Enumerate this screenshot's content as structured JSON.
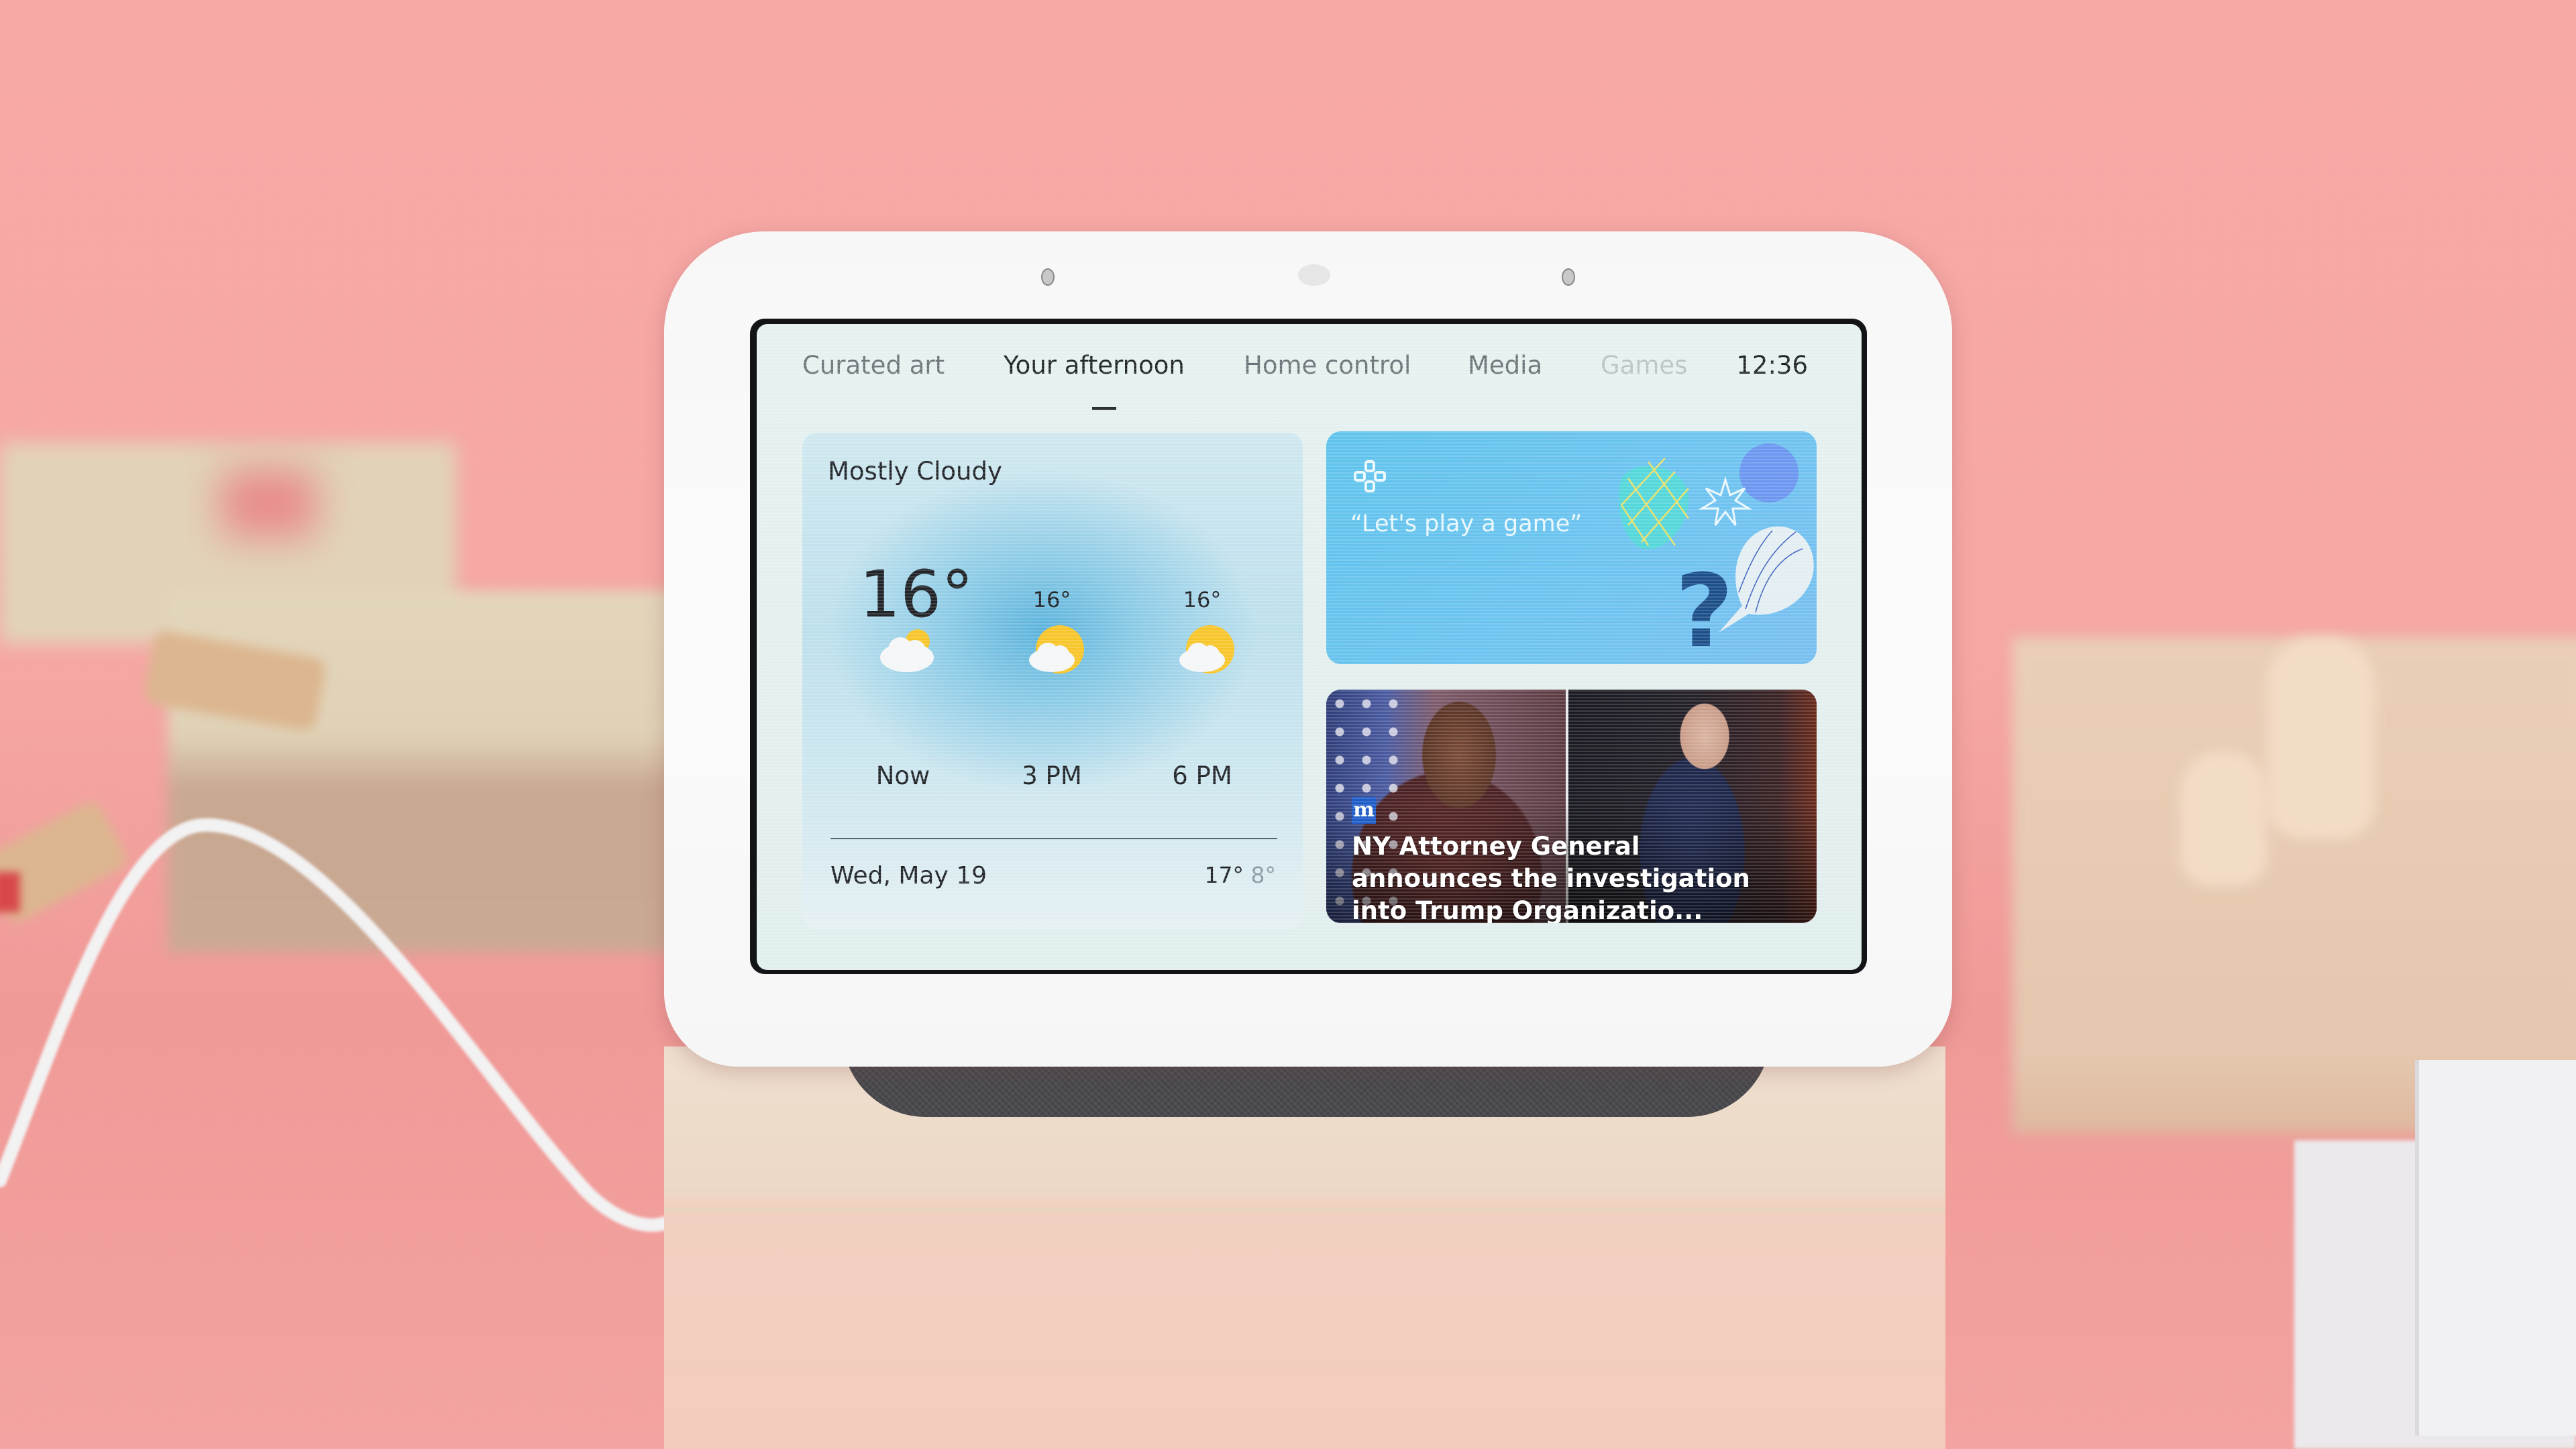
{
  "scene": {
    "description": "Smart display on a pink background",
    "colors": {
      "background": "#f7a9a6",
      "device": "#f8f8f8",
      "fabric": "#4a4a4e",
      "pedestal": "#efdfcf"
    }
  },
  "tabs": [
    {
      "label": "Curated art",
      "state": "inactive"
    },
    {
      "label": "Your afternoon",
      "state": "active"
    },
    {
      "label": "Home control",
      "state": "inactive"
    },
    {
      "label": "Media",
      "state": "inactive"
    },
    {
      "label": "Games",
      "state": "faded"
    }
  ],
  "clock": "12:36",
  "weather": {
    "condition": "Mostly Cloudy",
    "current_temp": "16°",
    "forecast": [
      {
        "label": "Now",
        "temp": "",
        "icon": "partly-cloudy-icon"
      },
      {
        "label": "3 PM",
        "temp": "16°",
        "icon": "mostly-sunny-icon"
      },
      {
        "label": "6 PM",
        "temp": "16°",
        "icon": "mostly-sunny-icon"
      }
    ],
    "date": "Wed, May 19",
    "high": "17°",
    "low": "8°"
  },
  "games_card": {
    "icon": "gamepad-icon",
    "prompt": "“Let's play a game”",
    "colors": {
      "bg": "#64c3ee",
      "question": "#1c4f8a"
    }
  },
  "news_card": {
    "source_badge": "m",
    "headline": "NY Attorney General announces the investigation into Trump Organizatio..."
  }
}
